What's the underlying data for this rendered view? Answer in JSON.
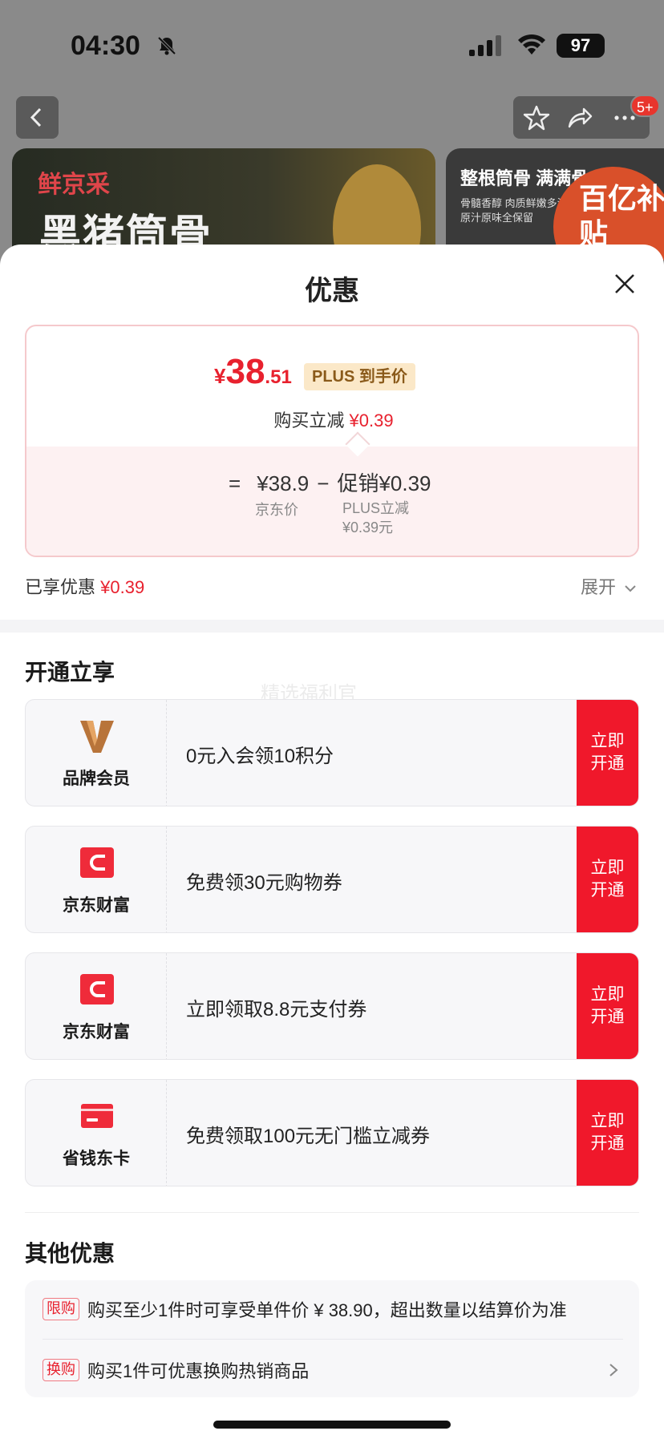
{
  "status_bar": {
    "time": "04:30",
    "battery": "97"
  },
  "nav": {
    "badge": "5+"
  },
  "banner": {
    "brand": "鲜京采",
    "title": "黑猪筒骨",
    "right_title": "整根筒骨 满满骨",
    "right_sub": "骨髓香醇 肉质鲜嫩多汁 原汁原味全保留",
    "subsidy": "百亿补贴"
  },
  "sheet": {
    "title": "优惠",
    "price": {
      "symbol": "¥",
      "integer": "38",
      "decimal": ".51",
      "tag": "PLUS 到手价"
    },
    "reduce": {
      "label": "购买立减",
      "value": "¥0.39"
    },
    "formula": {
      "eq": "=",
      "jd_price": "¥38.9",
      "minus": "−",
      "promo": "促销¥0.39",
      "jd_price_label": "京东价",
      "plus_label_1": "PLUS立减",
      "plus_label_2": "¥0.39元"
    },
    "enjoyed": {
      "label": "已享优惠",
      "value": "¥0.39"
    },
    "expand": "展开"
  },
  "open_section": {
    "title": "开通立享",
    "watermark": "精选福利官",
    "cards": [
      {
        "name": "品牌会员",
        "desc": "0元入会领10积分",
        "btn1": "立即",
        "btn2": "开通",
        "icon": "brand-v-icon"
      },
      {
        "name": "京东财富",
        "desc": "免费领30元购物券",
        "btn1": "立即",
        "btn2": "开通",
        "icon": "jd-wealth-icon"
      },
      {
        "name": "京东财富",
        "desc": "立即领取8.8元支付券",
        "btn1": "立即",
        "btn2": "开通",
        "icon": "jd-wealth-icon"
      },
      {
        "name": "省钱东卡",
        "desc": "免费领取100元无门槛立减券",
        "btn1": "立即",
        "btn2": "开通",
        "icon": "card-icon"
      }
    ]
  },
  "other_section": {
    "title": "其他优惠",
    "rows": [
      {
        "tag": "限购",
        "text": "购买至少1件时可享受单件价 ¥ 38.90，超出数量以结算价为准"
      },
      {
        "tag": "换购",
        "text": "购买1件可优惠换购热销商品"
      }
    ]
  },
  "colors": {
    "accent": "#f0182b",
    "price_red": "#e8212e",
    "plus_tag_bg": "#fbe8c8"
  }
}
